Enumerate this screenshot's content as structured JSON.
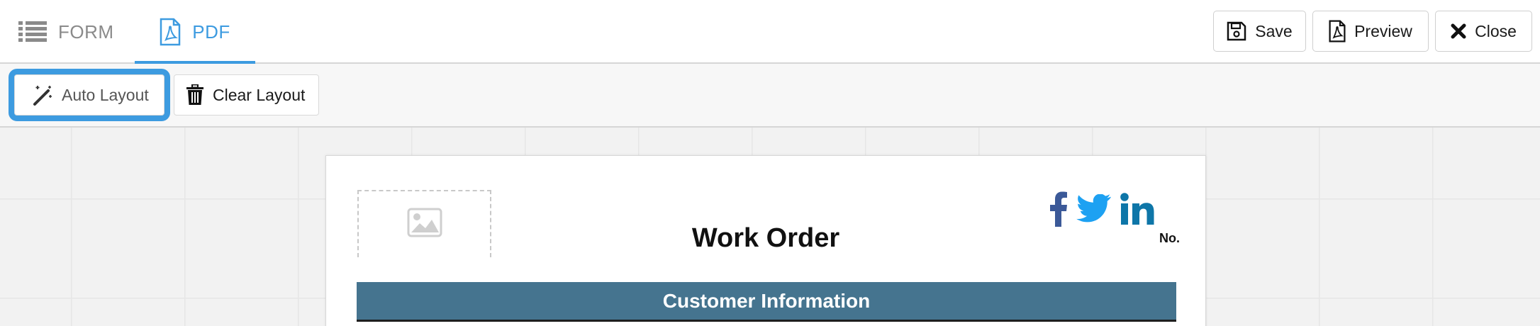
{
  "tabs": {
    "form_label": "FORM",
    "pdf_label": "PDF",
    "active": "PDF"
  },
  "header_actions": {
    "save_label": "Save",
    "preview_label": "Preview",
    "close_label": "Close"
  },
  "toolbar": {
    "auto_layout_label": "Auto Layout",
    "clear_layout_label": "Clear Layout"
  },
  "document": {
    "title": "Work Order",
    "number_label": "No.",
    "section_title": "Customer Information",
    "social_icons": [
      "facebook-icon",
      "twitter-icon",
      "linkedin-icon"
    ]
  },
  "colors": {
    "accent": "#3d9be0",
    "section_bar": "#45748f",
    "facebook": "#3b5998",
    "twitter": "#1da1f2",
    "linkedin": "#0e76a8"
  }
}
